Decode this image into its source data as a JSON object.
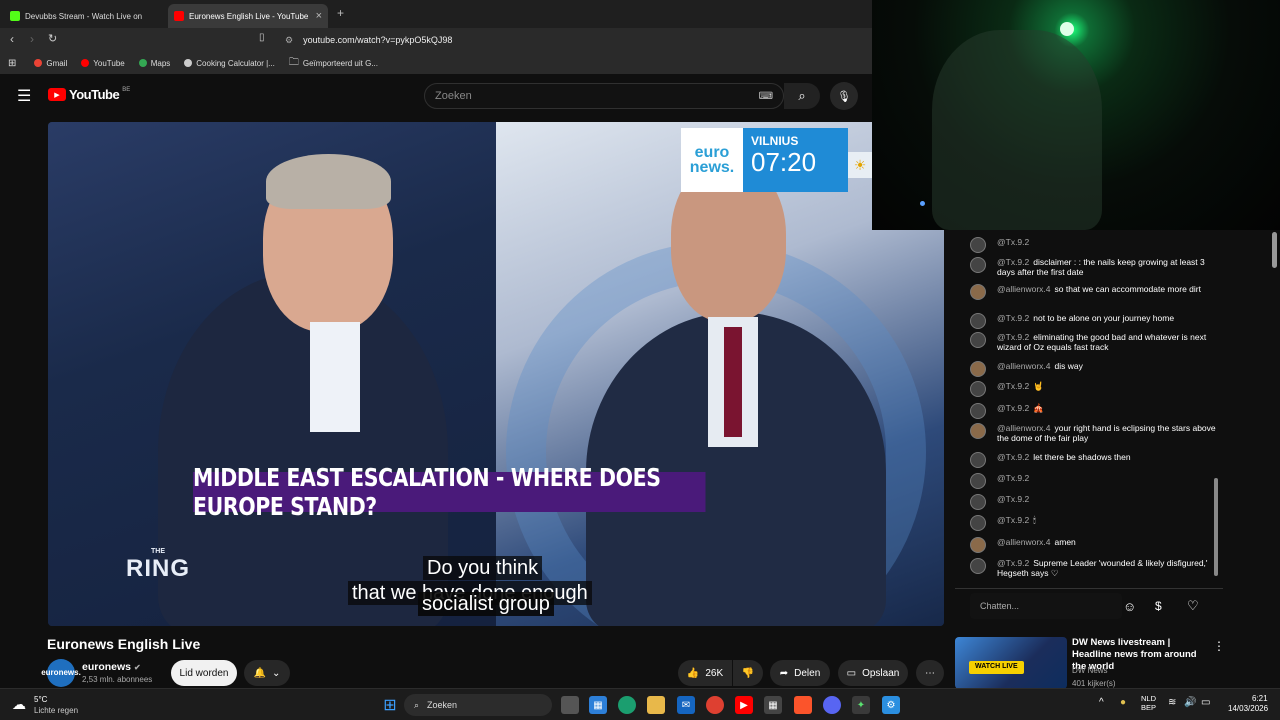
{
  "browser": {
    "tabs": [
      {
        "label": "Devubbs Stream - Watch Live on",
        "active": false
      },
      {
        "label": "Euronews English Live - YouTube",
        "active": true
      }
    ],
    "new_tab": "+",
    "url": "youtube.com/watch?v=pykpO5kQJ98",
    "bookmarks": [
      "Gmail",
      "YouTube",
      "Maps",
      "Cooking Calculator |...",
      "Geïmporteerd uit G..."
    ]
  },
  "youtube": {
    "logo_text": "YouTube",
    "region": "BE",
    "search_placeholder": "Zoeken"
  },
  "video": {
    "banner": "MIDDLE EAST ESCALATION - WHERE DOES EUROPE STAND?",
    "subtitle_line1": "Do you think",
    "subtitle_line2": "that we have done enough",
    "subtitle_line3": "socialist group",
    "show_logo_top": "THE",
    "show_logo": "RING",
    "brand_line1": "euro",
    "brand_line2": "news.",
    "city": "VILNIUS",
    "time": "07:20"
  },
  "watch": {
    "title": "Euronews English Live",
    "channel_name": "euronews",
    "channel_avatar_line1": "euro",
    "channel_avatar_line2": "news.",
    "subscribers": "2,53 mln. abonnees",
    "join_label": "Lid worden",
    "likes": "26K",
    "share_label": "Delen",
    "save_label": "Opslaan"
  },
  "chat": {
    "messages": [
      {
        "author": "@Tx.9.2",
        "text": ""
      },
      {
        "author": "@Tx.9.2",
        "text": "disclaimer : : the nails keep growing at least 3 days after the first date"
      },
      {
        "author": "@allienworx.4",
        "text": "so that we can accommodate more dirt"
      },
      {
        "author": "@Tx.9.2",
        "text": "not to be alone on your journey home"
      },
      {
        "author": "@Tx.9.2",
        "text": "eliminating the good bad and whatever is next wizard of Oz equals fast track"
      },
      {
        "author": "@allienworx.4",
        "text": "dis way"
      },
      {
        "author": "@Tx.9.2",
        "text": "🤘"
      },
      {
        "author": "@Tx.9.2",
        "text": "🎪"
      },
      {
        "author": "@allienworx.4",
        "text": "your right hand is eclipsing the stars above the dome of the fair play"
      },
      {
        "author": "@Tx.9.2",
        "text": "let there be shadows then"
      },
      {
        "author": "@Tx.9.2",
        "text": ""
      },
      {
        "author": "@Tx.9.2",
        "text": ""
      },
      {
        "author": "@Tx.9.2",
        "text": "🕯"
      },
      {
        "author": "@allienworx.4",
        "text": "amen"
      },
      {
        "author": "@Tx.9.2",
        "text": "Supreme Leader 'wounded & likely disfigured,' Hegseth says ♡"
      }
    ],
    "input_placeholder": "Chatten..."
  },
  "recommended": {
    "title": "DW News livestream | Headline news from around the world",
    "channel": "DW News",
    "viewers": "401 kijker(s)",
    "badge": "WATCH LIVE"
  },
  "taskbar": {
    "weather_temp": "5°C",
    "weather_desc": "Lichte regen",
    "search_placeholder": "Zoeken",
    "lang_line1": "NLD",
    "lang_line2": "BEP",
    "time": "6:21",
    "date": "14/03/2026"
  },
  "colors": {
    "youtube_red": "#ff0000",
    "euronews_blue": "#1f8bd6",
    "banner_purple": "#4a1a7a",
    "background": "#0f0f0f"
  }
}
